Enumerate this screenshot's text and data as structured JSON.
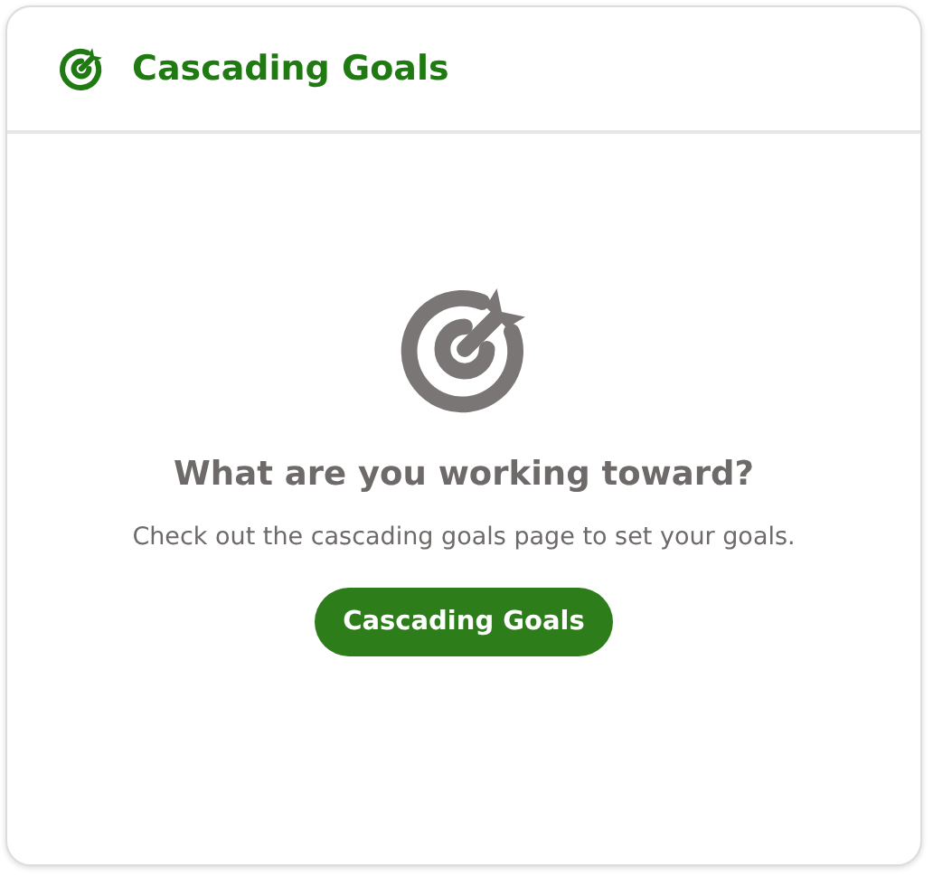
{
  "card": {
    "title": "Cascading Goals"
  },
  "empty_state": {
    "heading": "What are you working toward?",
    "message": "Check out the cascading goals page to set your goals.",
    "button": "Cascading Goals"
  }
}
